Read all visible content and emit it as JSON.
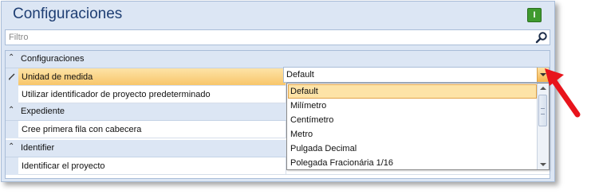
{
  "title": "Configuraciones",
  "info_icon_glyph": "I",
  "filter": {
    "placeholder": "Filtro"
  },
  "categories": [
    {
      "label": "Configuraciones"
    },
    {
      "label": "Expediente"
    },
    {
      "label": "Identifier"
    }
  ],
  "properties": {
    "unidad": {
      "name": "Unidad de medida",
      "value": "Default"
    },
    "utilizar": {
      "name": "Utilizar identificador de proyecto predeterminado"
    },
    "cree": {
      "name": "Cree primera fila con cabecera"
    },
    "identificar": {
      "name": "Identificar el proyecto"
    }
  },
  "dropdown": {
    "options": [
      "Default",
      "Milímetro",
      "Centímetro",
      "Metro",
      "Pulgada Decimal",
      "Polegada Fracionária 1/16"
    ],
    "selected": "Default"
  },
  "colors": {
    "accent": "#1e3e73",
    "selection": "#fde3a7",
    "arrow": "#e8141c",
    "info_button": "#3f9a2e"
  }
}
